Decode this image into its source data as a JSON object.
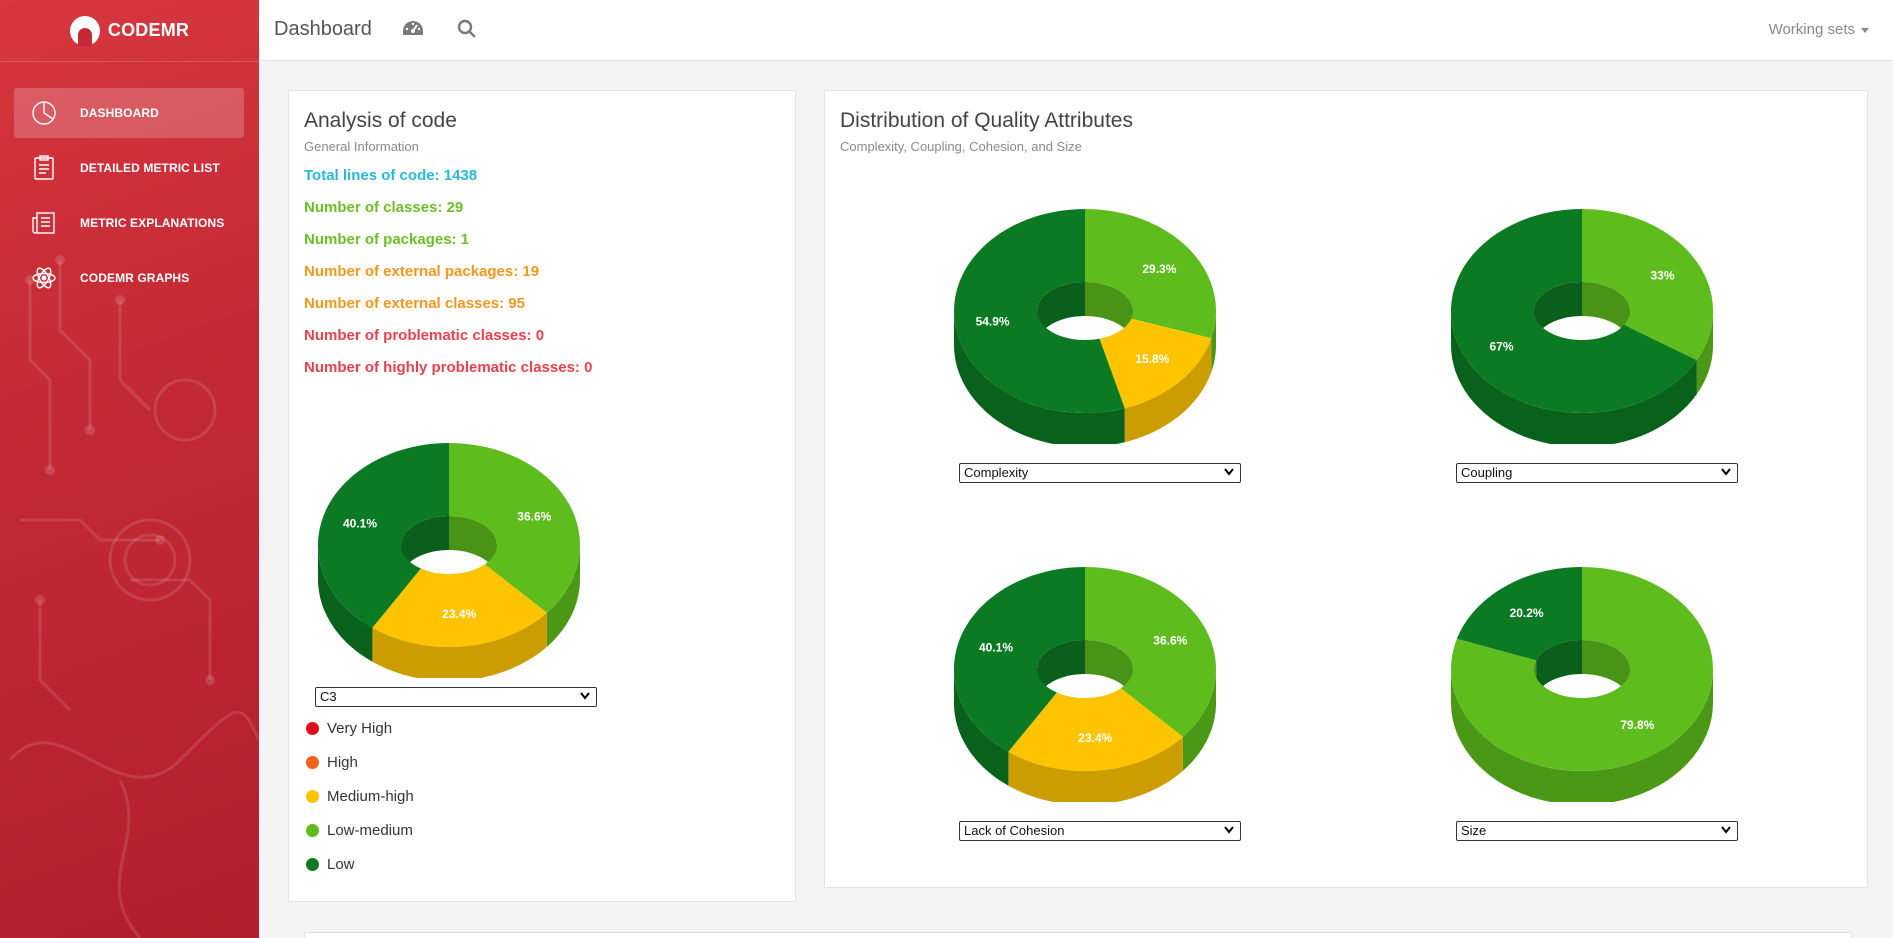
{
  "app": {
    "brand": "CODEMR",
    "page_title": "Dashboard",
    "working_sets": "Working sets"
  },
  "sidebar": {
    "items": [
      {
        "label": "DASHBOARD",
        "icon": "pie-chart-icon",
        "active": true
      },
      {
        "label": "DETAILED METRIC LIST",
        "icon": "clipboard-list-icon",
        "active": false
      },
      {
        "label": "METRIC EXPLANATIONS",
        "icon": "newspaper-icon",
        "active": false
      },
      {
        "label": "CODEMR GRAPHS",
        "icon": "atom-icon",
        "active": false
      }
    ]
  },
  "analysis": {
    "title": "Analysis of code",
    "subtitle": "General Information",
    "stats": [
      {
        "text": "Total lines of code: 1438",
        "color": "#28b9d8"
      },
      {
        "text": "Number of classes: 29",
        "color": "#6cbf26"
      },
      {
        "text": "Number of packages: 1",
        "color": "#6cbf26"
      },
      {
        "text": "Number of external packages: 19",
        "color": "#f39720"
      },
      {
        "text": "Number of external classes: 95",
        "color": "#f39720"
      },
      {
        "text": "Number of problematic classes: 0",
        "color": "#e8424e"
      },
      {
        "text": "Number of highly problematic classes: 0",
        "color": "#e8424e"
      }
    ],
    "select_value": "C3",
    "legend": [
      {
        "label": "Very High",
        "color": "#e0101a"
      },
      {
        "label": "High",
        "color": "#f2601c"
      },
      {
        "label": "Medium-high",
        "color": "#fec400"
      },
      {
        "label": "Low-medium",
        "color": "#5ebd1c"
      },
      {
        "label": "Low",
        "color": "#0b7a23"
      }
    ]
  },
  "distribution": {
    "title": "Distribution of Quality Attributes",
    "subtitle": "Complexity, Coupling, Cohesion, and Size"
  },
  "colors": {
    "low": "#0b7a23",
    "low_medium": "#5ebd1c",
    "medium_high": "#fec400"
  },
  "chart_data": [
    {
      "type": "pie",
      "select": "C3",
      "categories": [
        "Low-medium",
        "Medium-high",
        "Low"
      ],
      "values": [
        36.6,
        23.4,
        40.1
      ],
      "labels": [
        "36.6%",
        "23.4%",
        "40.1%"
      ]
    },
    {
      "type": "pie",
      "select": "Complexity",
      "categories": [
        "Low-medium",
        "Medium-high",
        "Low"
      ],
      "values": [
        29.3,
        15.8,
        54.9
      ],
      "labels": [
        "29.3%",
        "15.8%",
        "54.9%"
      ]
    },
    {
      "type": "pie",
      "select": "Coupling",
      "categories": [
        "Low-medium",
        "Low"
      ],
      "values": [
        33,
        67
      ],
      "labels": [
        "33%",
        "67%"
      ]
    },
    {
      "type": "pie",
      "select": "Lack of Cohesion",
      "categories": [
        "Low-medium",
        "Medium-high",
        "Low"
      ],
      "values": [
        36.6,
        23.4,
        40.1
      ],
      "labels": [
        "36.6%",
        "23.4%",
        "40.1%"
      ]
    },
    {
      "type": "pie",
      "select": "Size",
      "categories": [
        "Low-medium",
        "Low"
      ],
      "values": [
        79.8,
        20.2
      ],
      "labels": [
        "79.8%",
        "20.2%"
      ]
    }
  ]
}
